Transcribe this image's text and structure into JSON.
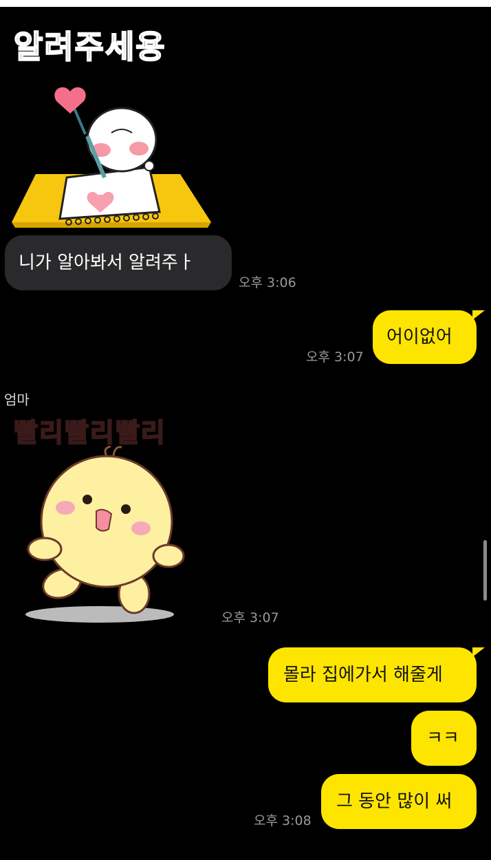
{
  "messages": {
    "m1_sticker_caption": "알려주세용",
    "m1_text": "니가 알아봐서 알려주ㅏ",
    "m1_time": "오후 3:06",
    "m2_text": "어이없어",
    "m2_time": "오후 3:07",
    "sender_name": "엄마",
    "m3_sticker_caption": "빨리빨리빨리",
    "m3_time": "오후 3:07",
    "m4_text": "몰라 집에가서 해줄게",
    "m5_text": "ㅋㅋ",
    "m6_text": "그 동안 많이 써",
    "m6_time": "오후 3:08"
  },
  "colors": {
    "background": "#000000",
    "incoming_bubble": "#2a2a2c",
    "outgoing_bubble": "#fee500"
  }
}
